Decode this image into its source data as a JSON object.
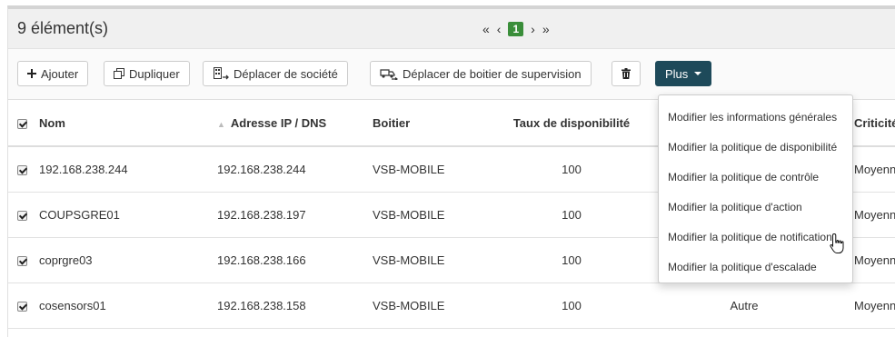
{
  "header": {
    "count": "9 élément(s)",
    "pager": {
      "first": "«",
      "prev": "‹",
      "current": "1",
      "next": "›",
      "last": "»"
    }
  },
  "toolbar": {
    "add_label": "Ajouter",
    "duplicate_label": "Dupliquer",
    "move_company_label": "Déplacer de société",
    "move_box_label": "Déplacer de boitier de supervision",
    "more_label": "Plus"
  },
  "table": {
    "columns": {
      "name": "Nom",
      "ip": "Adresse IP / DNS",
      "box": "Boitier",
      "availability": "Taux de disponibilité",
      "criticity": "Criticité"
    },
    "rows": [
      {
        "name": "192.168.238.244",
        "ip": "192.168.238.244",
        "box": "VSB-MOBILE",
        "availability": "100",
        "type": "",
        "criticity": "Moyenne"
      },
      {
        "name": "COUPSGRE01",
        "ip": "192.168.238.197",
        "box": "VSB-MOBILE",
        "availability": "100",
        "type": "",
        "criticity": "Moyenne"
      },
      {
        "name": "coprgre03",
        "ip": "192.168.238.166",
        "box": "VSB-MOBILE",
        "availability": "100",
        "type": "",
        "criticity": "Moyenne"
      },
      {
        "name": "cosensors01",
        "ip": "192.168.238.158",
        "box": "VSB-MOBILE",
        "availability": "100",
        "type": "Autre",
        "criticity": "Moyenne"
      }
    ]
  },
  "dropdown": {
    "items": [
      "Modifier les informations générales",
      "Modifier la politique de disponibilité",
      "Modifier la politique de contrôle",
      "Modifier la politique d'action",
      "Modifier la politique de notification",
      "Modifier la politique d'escalade"
    ]
  },
  "colors": {
    "primary": "#1e4a5a",
    "page_current": "#3a8e3a"
  }
}
